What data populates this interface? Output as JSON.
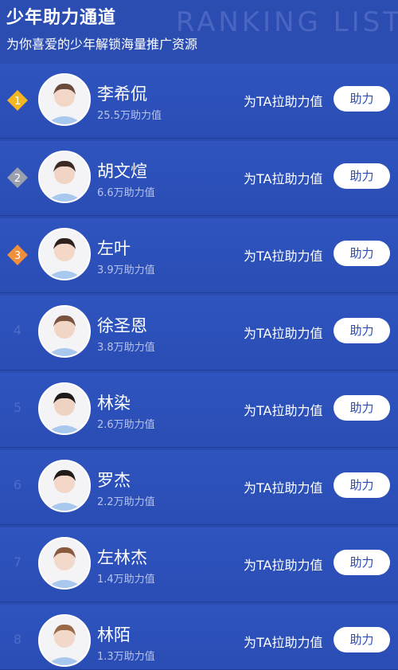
{
  "header": {
    "title": "少年助力通道",
    "watermark": "RANKING LIST",
    "subtitle": "为你喜爱的少年解锁海量推广资源"
  },
  "colors": {
    "background": "#2a4cb0",
    "rank_gold": "#f2b623",
    "rank_silver": "#9aa0ad",
    "rank_bronze": "#f28f3b",
    "button_bg": "#ffffff",
    "button_text": "#2a4cb0"
  },
  "ranking": [
    {
      "rank": "1",
      "name": "李希侃",
      "points": "25.5万助力值",
      "cta": "为TA拉助力值",
      "button": "助力",
      "badge": "gold-badge-icon"
    },
    {
      "rank": "2",
      "name": "胡文煊",
      "points": "6.6万助力值",
      "cta": "为TA拉助力值",
      "button": "助力",
      "badge": "silver-badge-icon"
    },
    {
      "rank": "3",
      "name": "左叶",
      "points": "3.9万助力值",
      "cta": "为TA拉助力值",
      "button": "助力",
      "badge": "bronze-badge-icon"
    },
    {
      "rank": "4",
      "name": "徐圣恩",
      "points": "3.8万助力值",
      "cta": "为TA拉助力值",
      "button": "助力"
    },
    {
      "rank": "5",
      "name": "林染",
      "points": "2.6万助力值",
      "cta": "为TA拉助力值",
      "button": "助力"
    },
    {
      "rank": "6",
      "name": "罗杰",
      "points": "2.2万助力值",
      "cta": "为TA拉助力值",
      "button": "助力"
    },
    {
      "rank": "7",
      "name": "左林杰",
      "points": "1.4万助力值",
      "cta": "为TA拉助力值",
      "button": "助力"
    },
    {
      "rank": "8",
      "name": "林陌",
      "points": "1.3万助力值",
      "cta": "为TA拉助力值",
      "button": "助力"
    }
  ]
}
